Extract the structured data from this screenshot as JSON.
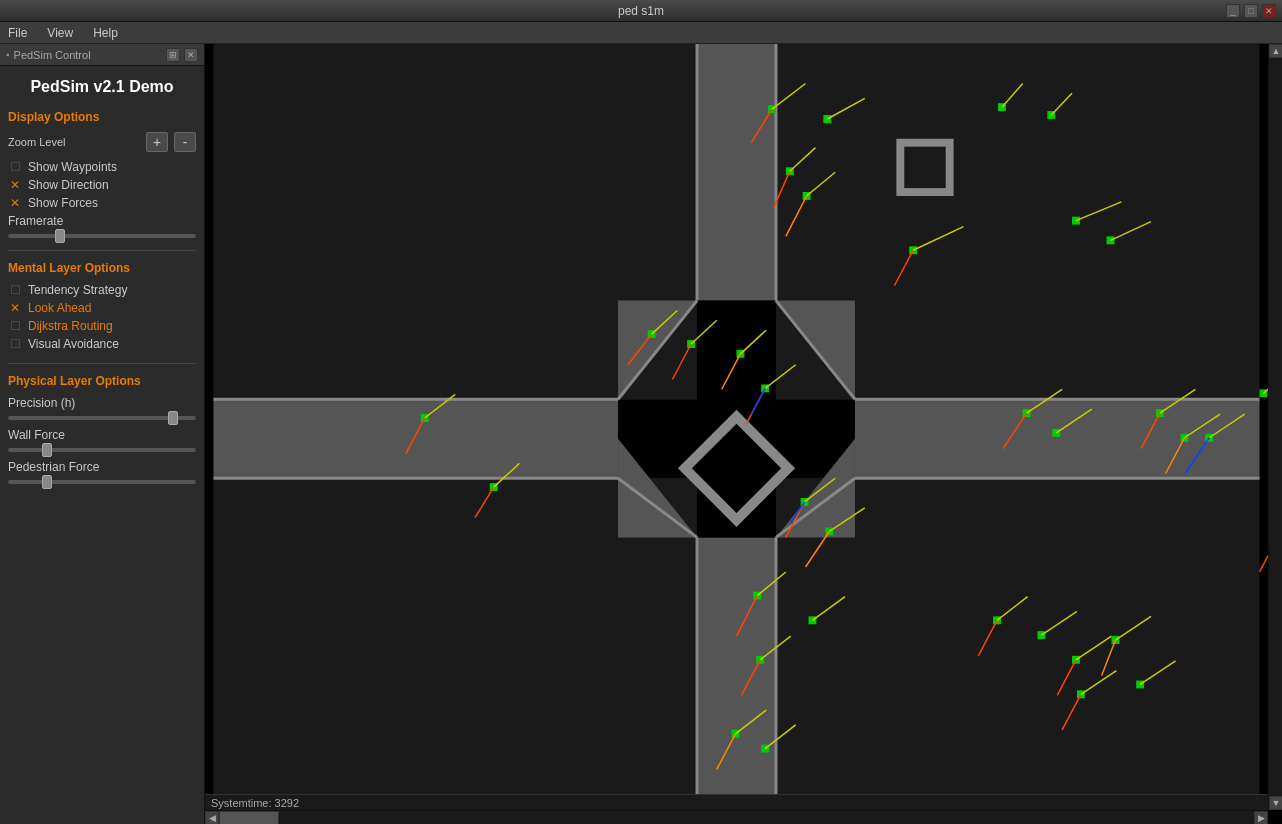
{
  "titlebar": {
    "title": "ped s1m",
    "min_label": "_",
    "max_label": "□",
    "close_label": "✕"
  },
  "menubar": {
    "items": [
      {
        "label": "File"
      },
      {
        "label": "View"
      },
      {
        "label": "Help"
      }
    ]
  },
  "panel": {
    "header_title": "PedSim Control",
    "app_title": "PedSim v2.1 Demo"
  },
  "display_options": {
    "title": "Display Options",
    "zoom_label": "Zoom Level",
    "zoom_plus": "+",
    "zoom_minus": "-",
    "show_waypoints_label": "Show Waypoints",
    "show_direction_label": "Show Direction",
    "show_forces_label": "Show Forces",
    "framerate_label": "Framerate"
  },
  "mental_layer": {
    "title": "Mental Layer Options",
    "tendency_strategy_label": "Tendency Strategy",
    "look_ahead_label": "Look Ahead",
    "dijkstra_routing_label": "Dijkstra Routing",
    "visual_avoidance_label": "Visual Avoidance"
  },
  "physical_layer": {
    "title": "Physical Layer Options",
    "precision_label": "Precision (h)",
    "wall_force_label": "Wall Force",
    "pedestrian_force_label": "Pedestrian Force"
  },
  "statusbar": {
    "text": "Systemtime: 3292"
  }
}
